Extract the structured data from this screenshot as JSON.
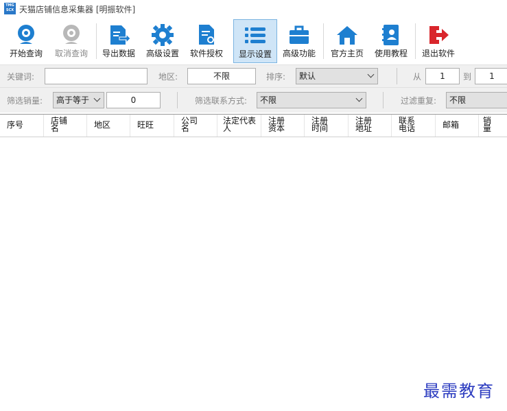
{
  "window": {
    "title": "天猫店铺信息采集器 [明振软件]",
    "icon_text": "TMG SCX"
  },
  "toolbar": [
    {
      "label": "开始查询",
      "icon": "webcam-icon",
      "state": "normal"
    },
    {
      "label": "取消查询",
      "icon": "webcam-disabled-icon",
      "state": "disabled"
    },
    {
      "label": "导出数据",
      "icon": "export-document-icon",
      "state": "normal"
    },
    {
      "label": "高级设置",
      "icon": "gear-icon",
      "state": "normal"
    },
    {
      "label": "软件授权",
      "icon": "license-document-icon",
      "state": "normal"
    },
    {
      "label": "显示设置",
      "icon": "list-icon",
      "state": "active"
    },
    {
      "label": "高级功能",
      "icon": "briefcase-icon",
      "state": "normal"
    },
    {
      "label": "官方主页",
      "icon": "home-icon",
      "state": "normal"
    },
    {
      "label": "使用教程",
      "icon": "book-icon",
      "state": "normal"
    },
    {
      "label": "退出软件",
      "icon": "exit-icon",
      "state": "normal"
    }
  ],
  "filters": {
    "keyword_label": "关键词:",
    "keyword_value": "",
    "region_label": "地区:",
    "region_value": "不限",
    "sort_label": "排序:",
    "sort_value": "默认",
    "from_label": "从",
    "from_value": "1",
    "to_label": "到",
    "to_value": "1",
    "sales_label": "筛选销量:",
    "sales_op": "高于等于",
    "sales_value": "0",
    "contact_label": "筛选联系方式:",
    "contact_value": "不限",
    "dedup_label": "过滤重复:",
    "dedup_value": "不限"
  },
  "table": {
    "columns": [
      "序号",
      "店铺名",
      "地区",
      "旺旺",
      "公司名",
      "法定代表人",
      "注册资本",
      "注册时间",
      "注册地址",
      "联系电话",
      "邮箱",
      "销量"
    ],
    "rows": []
  },
  "watermark": "最需教育",
  "colors": {
    "accent": "#1e7fd0",
    "exit": "#d9262c",
    "active_bg": "#cfe5f7",
    "watermark": "#2c3cc0"
  }
}
